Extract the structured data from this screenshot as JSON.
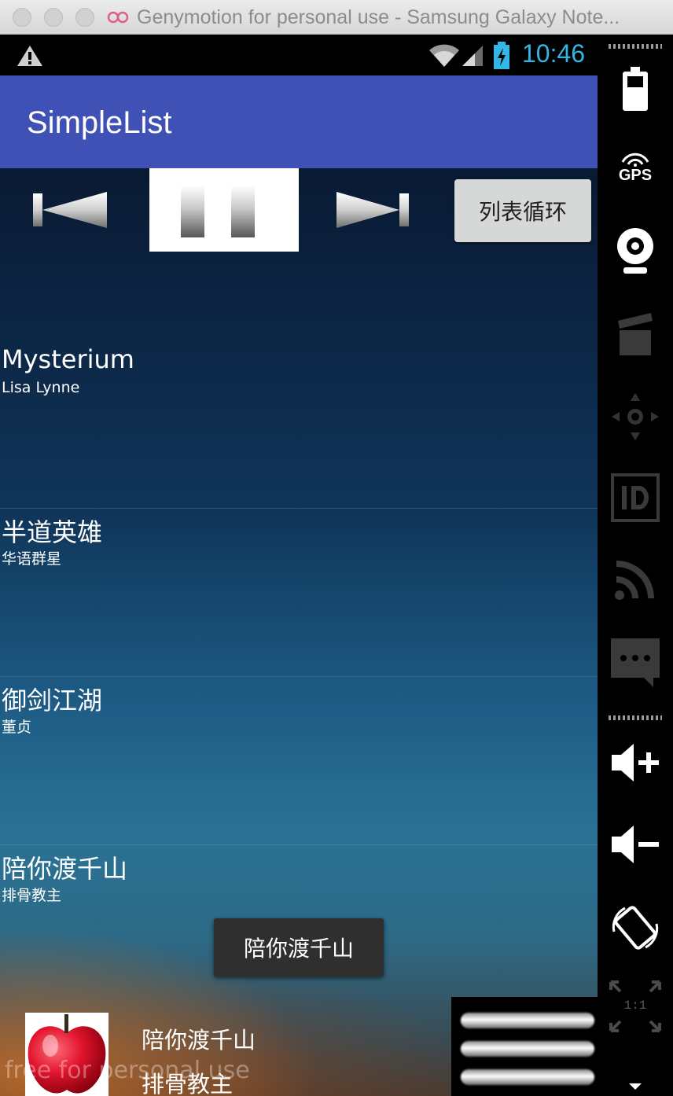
{
  "window": {
    "title": "Genymotion for personal use - Samsung Galaxy Note..."
  },
  "status_bar": {
    "time": "10:46",
    "time_color": "#33b5e5"
  },
  "app_bar": {
    "title": "SimpleList",
    "color": "#3f51b5"
  },
  "controls": {
    "prev_icon": "skip-previous-icon",
    "pause_icon": "pause-icon",
    "next_icon": "skip-next-icon",
    "mode_button_label": "列表循环"
  },
  "songs": [
    {
      "title": "Mysterium",
      "artist": "Lisa Lynne"
    },
    {
      "title": "半道英雄",
      "artist": "华语群星"
    },
    {
      "title": "御剑江湖",
      "artist": "董贞"
    },
    {
      "title": "陪你渡千山",
      "artist": "排骨教主"
    }
  ],
  "toast": {
    "text": "陪你渡千山"
  },
  "now_playing": {
    "title": "陪你渡千山",
    "artist": "排骨教主",
    "cover_icon": "apple-cover-icon"
  },
  "watermark": "free for personal use",
  "sidebar": {
    "gps_label": "GPS",
    "ratio_label": "1:1",
    "icons": [
      "battery-icon",
      "gps-icon",
      "webcam-icon",
      "media-icon",
      "dpad-icon",
      "id-icon",
      "network-icon",
      "sms-icon",
      "volume-up-icon",
      "volume-down-icon",
      "rotate-icon",
      "pixel-ratio-icon"
    ]
  }
}
